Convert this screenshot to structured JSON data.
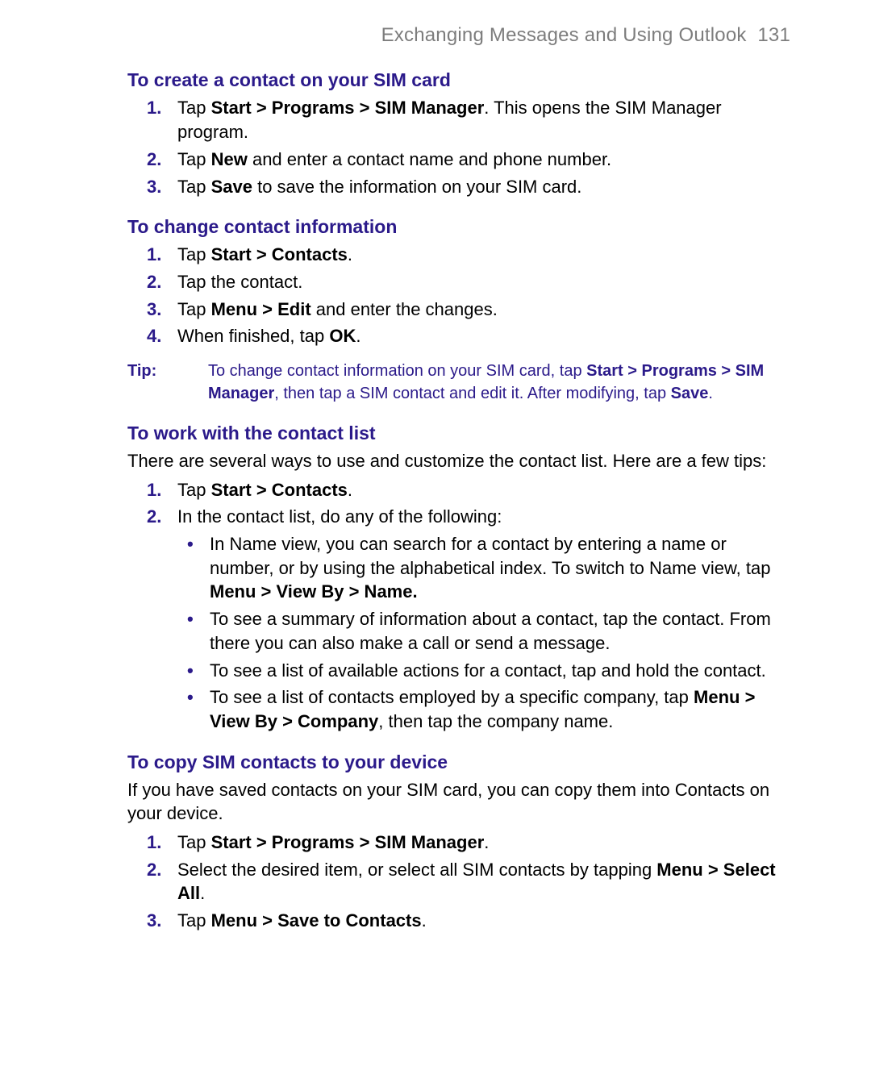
{
  "header": {
    "title": "Exchanging Messages and Using Outlook",
    "page_number": "131"
  },
  "sections": [
    {
      "heading": "To create a contact on your SIM card",
      "steps": [
        {
          "pre": "Tap ",
          "bold": "Start > Programs > SIM Manager",
          "post": ". This opens the SIM Manager program."
        },
        {
          "pre": "Tap ",
          "bold": "New",
          "post": " and enter a contact name and phone number."
        },
        {
          "pre": "Tap ",
          "bold": "Save",
          "post": " to save the information on your SIM card."
        }
      ]
    },
    {
      "heading": "To change contact information",
      "steps": [
        {
          "pre": "Tap ",
          "bold": "Start > Contacts",
          "post": "."
        },
        {
          "pre": "Tap the contact.",
          "bold": "",
          "post": ""
        },
        {
          "pre": "Tap ",
          "bold": "Menu > Edit",
          "post": " and enter the changes."
        },
        {
          "pre": "When finished, tap ",
          "bold": "OK",
          "post": "."
        }
      ]
    }
  ],
  "tip": {
    "label": "Tip:",
    "t1": "To change contact information on your SIM card, tap ",
    "b1": "Start > Programs > SIM Manager",
    "t2": ", then tap a SIM contact and edit it. After modifying, tap ",
    "b2": "Save",
    "t3": "."
  },
  "worklist": {
    "heading": "To work with the contact list",
    "intro": "There are several ways to use and customize the contact list. Here are a few tips:",
    "step1": {
      "pre": "Tap ",
      "bold": "Start > Contacts",
      "post": "."
    },
    "step2_intro": "In the contact list, do any of the following:",
    "bullets": [
      {
        "pre": "In Name view, you can search for a contact by entering a name or number, or by using the alphabetical index. To switch to Name view, tap ",
        "bold": "Menu > View By > Name.",
        "post": ""
      },
      {
        "pre": "To see a summary of information about a contact, tap the contact. From there you can also make a call or send a message.",
        "bold": "",
        "post": ""
      },
      {
        "pre": "To see a list of available actions for a contact, tap and hold the contact.",
        "bold": "",
        "post": ""
      },
      {
        "pre": "To see a list of contacts employed by a specific company, tap ",
        "bold": "Menu > View By > Company",
        "post": ", then tap the company name."
      }
    ]
  },
  "copysim": {
    "heading": "To copy SIM contacts to your device",
    "intro": "If you have saved contacts on your SIM card, you can copy them into Contacts on your device.",
    "steps": [
      {
        "pre": "Tap ",
        "bold": "Start > Programs > SIM Manager",
        "post": "."
      },
      {
        "pre": "Select the desired item, or select all SIM contacts by tapping ",
        "bold": "Menu > Select All",
        "post": "."
      },
      {
        "pre": "Tap ",
        "bold": "Menu > Save to Contacts",
        "post": "."
      }
    ]
  }
}
